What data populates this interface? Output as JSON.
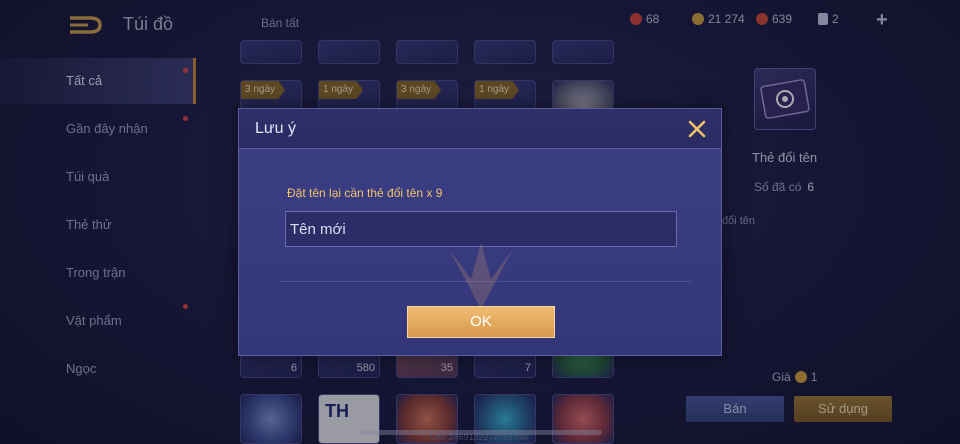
{
  "topbar": {
    "title": "Túi đồ",
    "sell_all": "Bán tất",
    "currencies": [
      {
        "icon": "red-gem-icon",
        "value": "68",
        "color": "#d6453f"
      },
      {
        "icon": "gold-coin-icon",
        "value": "21 274",
        "color": "#d3a43f"
      },
      {
        "icon": "red-voucher-icon",
        "value": "639",
        "color": "#cf4a3a"
      },
      {
        "icon": "card-icon",
        "value": "2",
        "color": "#c8cbe6"
      }
    ],
    "add_label": "+"
  },
  "sidebar": {
    "items": [
      {
        "label": "Tất cả",
        "active": true,
        "dot": true
      },
      {
        "label": "Gần đây nhận",
        "active": false,
        "dot": true
      },
      {
        "label": "Túi quà",
        "active": false,
        "dot": false
      },
      {
        "label": "Thẻ thử",
        "active": false,
        "dot": false
      },
      {
        "label": "Trong trận",
        "active": false,
        "dot": false
      },
      {
        "label": "Vật phẩm",
        "active": false,
        "dot": true
      },
      {
        "label": "Ngọc",
        "active": false,
        "dot": false
      }
    ]
  },
  "grid": {
    "tags": [
      "3 ngày",
      "1 ngày",
      "3 ngày",
      "1 ngày"
    ],
    "counts": [
      "6",
      "580",
      "35",
      "7"
    ],
    "tile_text": "TH"
  },
  "detail": {
    "name": "Thẻ đổi tên",
    "owned_label": "Số đã có",
    "owned_value": "6",
    "desc_fragment": "đổi tên",
    "price_label": "Giá",
    "price_value": "1",
    "sell_label": "Bán",
    "use_label": "Sử dụng"
  },
  "uid": "Uid: 2469132272721346",
  "dialog": {
    "title": "Lưu ý",
    "message": "Đặt tên lại cần thẻ đổi tên x 9",
    "input_placeholder": "Tên mới",
    "input_value": "",
    "ok_label": "OK"
  }
}
